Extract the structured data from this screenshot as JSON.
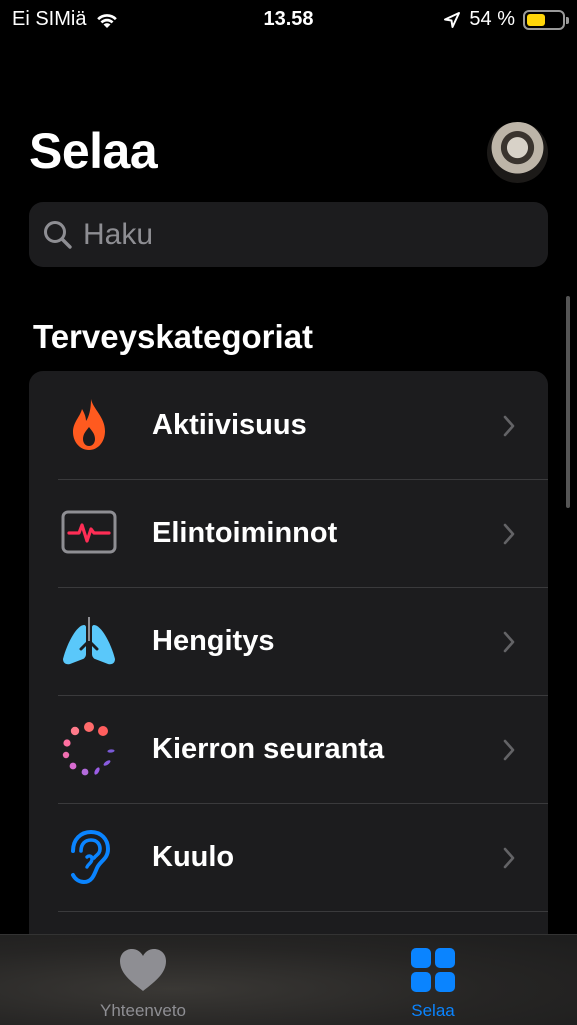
{
  "status_bar": {
    "carrier": "Ei SIMiä",
    "time": "13.58",
    "battery_text": "54 %",
    "battery_level": 0.54,
    "battery_color": "#ffd60a",
    "icons": [
      "wifi-icon",
      "location-arrow-icon",
      "battery-icon"
    ]
  },
  "header": {
    "title": "Selaa"
  },
  "search": {
    "placeholder": "Haku",
    "icon": "magnifier-icon"
  },
  "section": {
    "title": "Terveyskategoriat"
  },
  "categories": [
    {
      "label": "Aktiivisuus",
      "icon": "flame-icon",
      "color": "#ff5a1f"
    },
    {
      "label": "Elintoiminnot",
      "icon": "vitals-monitor-icon",
      "color": "#ff2d55"
    },
    {
      "label": "Hengitys",
      "icon": "lungs-icon",
      "color": "#5ac8fa"
    },
    {
      "label": "Kierron seuranta",
      "icon": "cycle-dots-icon",
      "color": "#ff6b6b"
    },
    {
      "label": "Kuulo",
      "icon": "ear-icon",
      "color": "#0a84ff"
    }
  ],
  "tab_bar": {
    "tabs": [
      {
        "label": "Yhteenveto",
        "icon": "heart-icon",
        "selected": false
      },
      {
        "label": "Selaa",
        "icon": "grid-icon",
        "selected": true
      }
    ],
    "active_color": "#0a84ff",
    "inactive_color": "#8e8e93"
  }
}
